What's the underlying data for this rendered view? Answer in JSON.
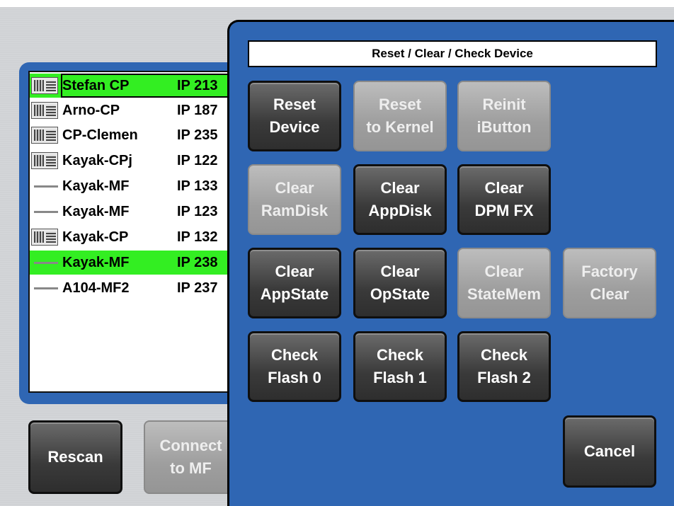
{
  "device_list": {
    "rows": [
      {
        "name": "Stefan CP",
        "ip": "IP 213",
        "icon": "control-panel-icon",
        "selected": true
      },
      {
        "name": "Arno-CP",
        "ip": "IP 187",
        "icon": "control-panel-icon",
        "selected": false
      },
      {
        "name": "CP-Clemen",
        "ip": "IP 235",
        "icon": "control-panel-icon",
        "selected": false
      },
      {
        "name": "Kayak-CPj",
        "ip": "IP 122",
        "icon": "control-panel-icon",
        "selected": false
      },
      {
        "name": "Kayak-MF",
        "ip": "IP 133",
        "icon": "mainframe-icon",
        "selected": false
      },
      {
        "name": "Kayak-MF",
        "ip": "IP 123",
        "icon": "mainframe-icon",
        "selected": false
      },
      {
        "name": "Kayak-CP",
        "ip": "IP 132",
        "icon": "control-panel-icon",
        "selected": false
      },
      {
        "name": "Kayak-MF",
        "ip": "IP 238",
        "icon": "mainframe-icon",
        "selected": true
      },
      {
        "name": "A104-MF2",
        "ip": "IP 237",
        "icon": "mainframe-icon",
        "selected": false
      }
    ],
    "selection_color": "#33ee22"
  },
  "bottom_buttons": {
    "rescan": "Rescan",
    "connect": "Connect\nto MF"
  },
  "dialog": {
    "title": "Reset / Clear / Check Device",
    "background_color": "#2f66b3",
    "buttons": {
      "reset_device": {
        "label": "Reset\nDevice",
        "enabled": true
      },
      "reset_kernel": {
        "label": "Reset\nto Kernel",
        "enabled": false
      },
      "reinit_ibutton": {
        "label": "Reinit\niButton",
        "enabled": false
      },
      "clear_ramdisk": {
        "label": "Clear\nRamDisk",
        "enabled": false
      },
      "clear_appdisk": {
        "label": "Clear\nAppDisk",
        "enabled": true
      },
      "clear_dpmfx": {
        "label": "Clear\nDPM FX",
        "enabled": true
      },
      "clear_appstate": {
        "label": "Clear\nAppState",
        "enabled": true
      },
      "clear_opstate": {
        "label": "Clear\nOpState",
        "enabled": true
      },
      "clear_statemem": {
        "label": "Clear\nStateMem",
        "enabled": false
      },
      "factory_clear": {
        "label": "Factory\nClear",
        "enabled": false
      },
      "check_flash0": {
        "label": "Check\nFlash 0",
        "enabled": true
      },
      "check_flash1": {
        "label": "Check\nFlash 1",
        "enabled": true
      },
      "check_flash2": {
        "label": "Check\nFlash 2",
        "enabled": true
      },
      "cancel": {
        "label": "Cancel",
        "enabled": true
      }
    }
  }
}
